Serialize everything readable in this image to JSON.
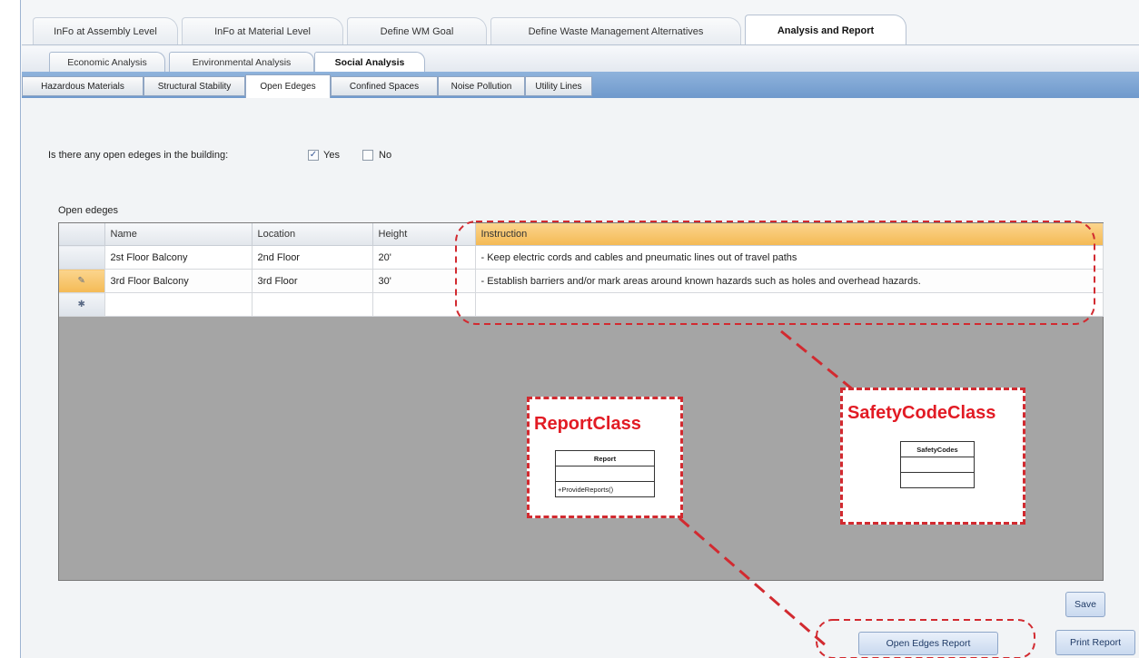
{
  "tabs_main": [
    {
      "label": "InFo at Assembly Level"
    },
    {
      "label": "InFo at Material Level"
    },
    {
      "label": "Define WM Goal"
    },
    {
      "label": "Define Waste Management Alternatives"
    },
    {
      "label": "Analysis and Report"
    }
  ],
  "tabs_analysis": [
    {
      "label": "Economic Analysis"
    },
    {
      "label": "Environmental Analysis"
    },
    {
      "label": "Social Analysis"
    }
  ],
  "tabs_social": [
    {
      "label": "Hazardous Materials"
    },
    {
      "label": "Structural Stability"
    },
    {
      "label": "Open Edeges"
    },
    {
      "label": "Confined Spaces"
    },
    {
      "label": "Noise Pollution"
    },
    {
      "label": "Utility Lines"
    }
  ],
  "question": {
    "text": "Is there any open edeges in the building:",
    "yes_label": "Yes",
    "no_label": "No",
    "yes_checked": "✓"
  },
  "grid": {
    "group_label": "Open edeges",
    "columns": [
      "Name",
      "Location",
      "Height",
      "Instruction"
    ],
    "rows": [
      {
        "indicator": "",
        "name": "2st Floor Balcony",
        "location": "2nd Floor",
        "height": "20'",
        "instruction": "- Keep electric cords and cables and pneumatic lines out of travel paths"
      },
      {
        "indicator": "✎",
        "name": "3rd Floor Balcony",
        "location": "3rd Floor",
        "height": "30'",
        "instruction": "- Establish barriers and/or mark areas around known hazards such as holes and overhead hazards."
      }
    ],
    "new_row_indicator": "✱"
  },
  "buttons": {
    "save": "Save",
    "open_edges_report": "Open Edges Report",
    "print_report": "Print Report"
  },
  "annotations": {
    "report_class": {
      "title": "ReportClass",
      "uml_name": "Report",
      "uml_method": "+ProvideReports()"
    },
    "safety_code_class": {
      "title": "SafetyCodeClass",
      "uml_name": "SafetyCodes"
    },
    "accent_color": "#d22a30"
  }
}
